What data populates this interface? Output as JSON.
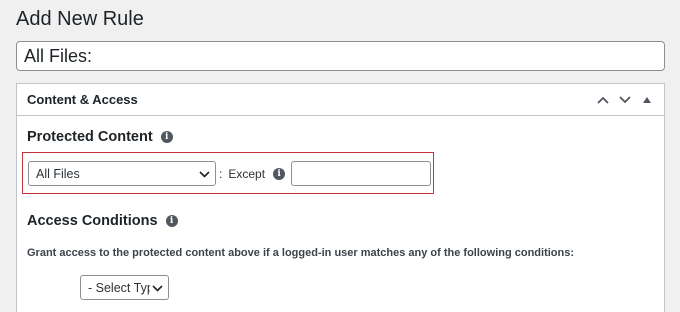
{
  "page": {
    "title": "Add New Rule"
  },
  "rule_title_input": {
    "value": "All Files:"
  },
  "metabox": {
    "title": "Content & Access",
    "icons": {
      "move_up": "chevron-up-icon",
      "move_down": "chevron-down-icon",
      "toggle": "triangle-up-icon"
    }
  },
  "protected_content": {
    "heading": "Protected Content",
    "info_icon": "info-icon",
    "select_value": "All Files",
    "separator": ":",
    "except_label": "Except",
    "except_value": ""
  },
  "access_conditions": {
    "heading": "Access Conditions",
    "info_icon": "info-icon",
    "description": "Grant access to the protected content above if a logged-in user matches any of the following conditions:",
    "type_select_value": "- Select Typ"
  },
  "colors": {
    "background": "#f0f0f1",
    "highlight_border": "#c4323a",
    "border": "#c3c4c7"
  }
}
